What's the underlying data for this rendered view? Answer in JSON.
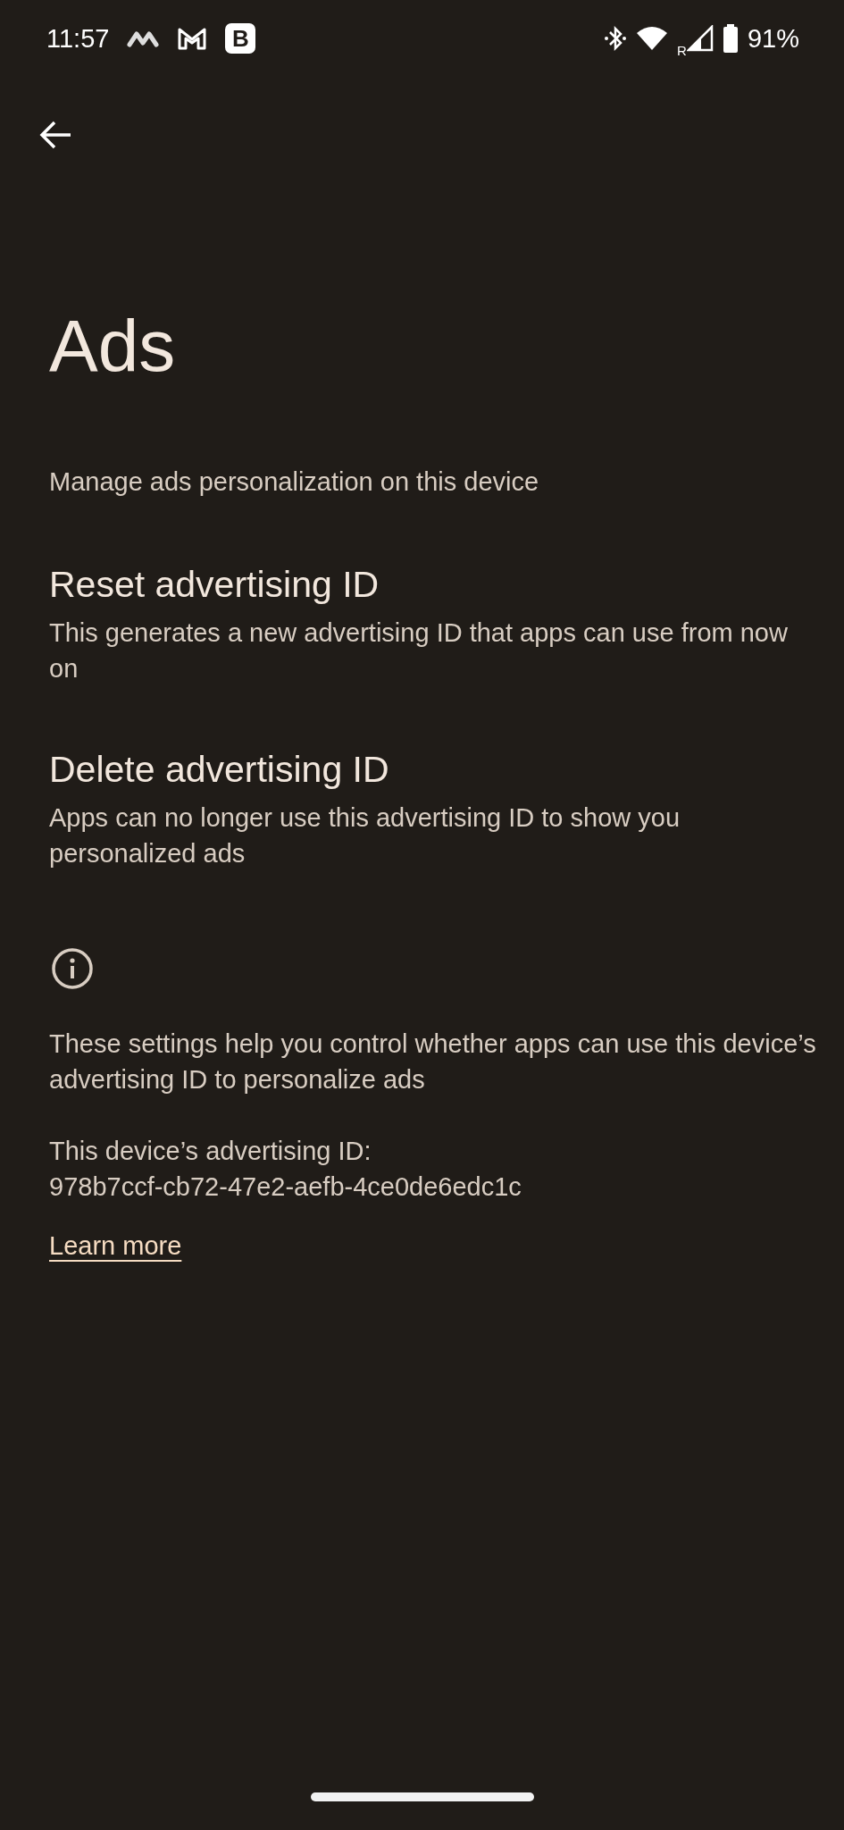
{
  "status_bar": {
    "time": "11:57",
    "badge_letter": "B",
    "roaming": "R",
    "battery": "91%"
  },
  "title": "Ads",
  "subtitle": "Manage ads personalization on this device",
  "items": [
    {
      "title": "Reset advertising ID",
      "summary": "This generates a new advertising ID that apps can use from now on"
    },
    {
      "title": "Delete advertising ID",
      "summary": "Apps can no longer use this advertising ID to show you personalized ads"
    }
  ],
  "footer": {
    "description": "These settings help you control whether apps can use this device’s advertising ID to personalize ads",
    "id_label": "This device’s advertising ID:",
    "id_value": "978b7ccf-cb72-47e2-aefb-4ce0de6edc1c",
    "link": "Learn more"
  }
}
